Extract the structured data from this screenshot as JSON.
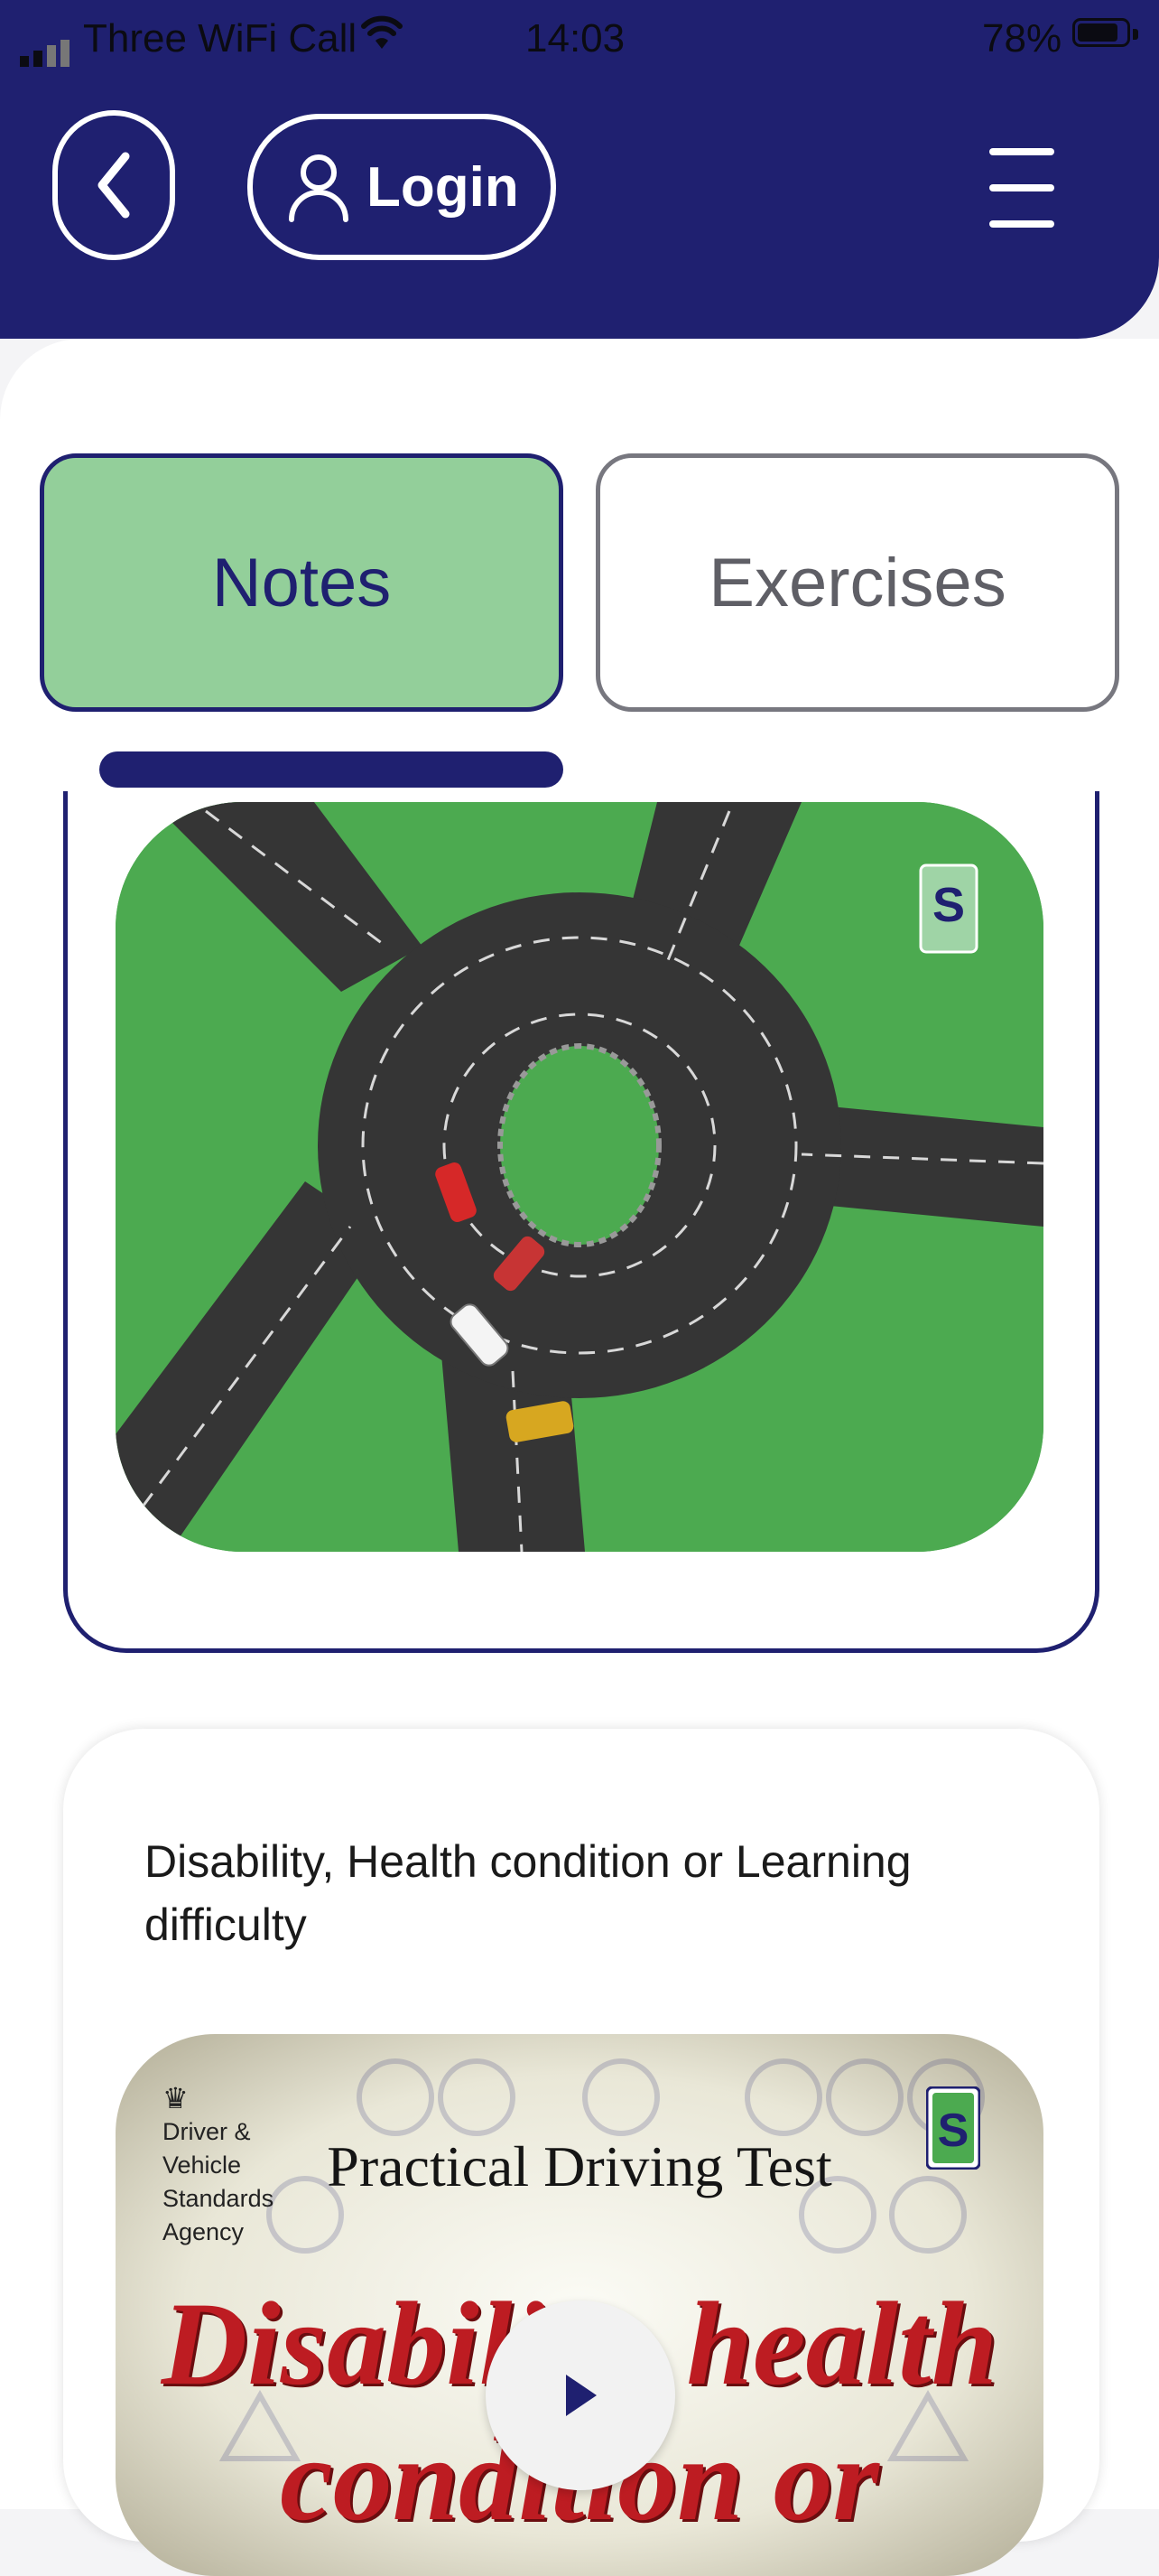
{
  "status_bar": {
    "carrier": "Three WiFi Call",
    "time": "14:03",
    "battery": "78%"
  },
  "header": {
    "login_label": "Login"
  },
  "tabs": [
    {
      "label": "Notes",
      "selected": true
    },
    {
      "label": "Exercises",
      "selected": false
    }
  ],
  "cards": [
    {
      "image": "roundabout-illustration"
    },
    {
      "title": "Disability, Health condition or Learning difficulty",
      "video": {
        "logo_text": "Driver & Vehicle Standards Agency",
        "title": "Practical Driving Test",
        "subtitle": "Disability, health condition or"
      }
    }
  ],
  "colors": {
    "header_bg": "#1f2070",
    "tab_selected_bg": "#93cf9a",
    "tab_border": "#1f2070",
    "grass": "#4caa50",
    "road": "#333333",
    "video_title_red": "#bd1c22"
  }
}
